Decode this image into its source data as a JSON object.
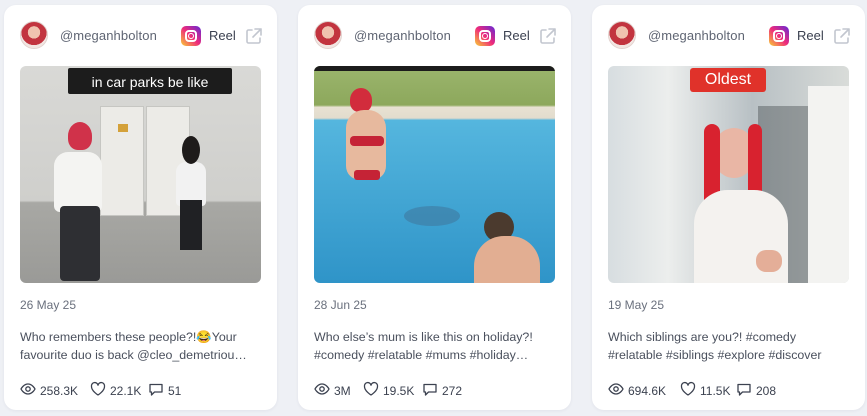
{
  "colors": {
    "background": "#eef0f5",
    "card": "#ffffff",
    "text_muted": "#6a707d",
    "oldest_label": "#e0322a"
  },
  "cards": [
    {
      "handle": "@meganhbolton",
      "type_label": "Reel",
      "overlay_text": "in car parks be like",
      "date": "26 May 25",
      "caption_line1": "Who remembers these people?!😂Your",
      "caption_line2": "favourite duo is back @cleo_demetriou…",
      "views": "258.3K",
      "likes": "22.1K",
      "comments": "51"
    },
    {
      "handle": "@meganhbolton",
      "type_label": "Reel",
      "date": "28 Jun 25",
      "caption_line1": "Who else’s mum is like this on holiday?!",
      "caption_line2": "#comedy #relatable #mums #holiday…",
      "views": "3M",
      "likes": "19.5K",
      "comments": "272"
    },
    {
      "handle": "@meganhbolton",
      "type_label": "Reel",
      "overlay_text": "Oldest",
      "date": "19 May 25",
      "caption_line1": "Which siblings are you?! #comedy",
      "caption_line2": "#relatable #siblings #explore #discover",
      "views": "694.6K",
      "likes": "11.5K",
      "comments": "208"
    }
  ],
  "icons": {
    "platform": "instagram-icon",
    "external": "external-link-icon",
    "views": "eye-icon",
    "likes": "heart-icon",
    "comments": "comment-icon"
  }
}
